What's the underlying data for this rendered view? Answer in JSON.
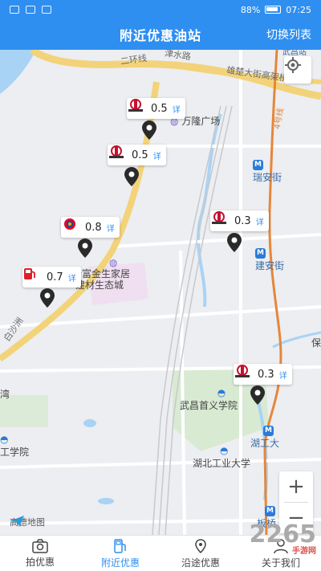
{
  "statusbar": {
    "battery": "88%",
    "time": "07:25"
  },
  "header": {
    "title": "附近优惠油站",
    "switch_label": "切换列表"
  },
  "map": {
    "labels": {
      "ring_road": "二环线",
      "jinshui_road": "津水路",
      "xiongchu_elevated": "雄楚大街高架桥",
      "wuchang_north": "武昌站",
      "line4": "4号线",
      "ruianjie": "瑞安街",
      "jiananjie": "建安街",
      "wanlong_plaza": "万隆广场",
      "hefujin_l1": "合富金生家居",
      "hefujin_l2": "建材生态城",
      "baisha": "白沙洲",
      "wan": "湾",
      "school_left": "工学院",
      "wuchang_shouyi": "武昌首义学院",
      "hugongda": "湖工大",
      "hubei_uni_tech": "湖北工业大学",
      "banqiao": "板桥",
      "bao": "保"
    },
    "stations": [
      {
        "brand": "sinopec",
        "price": "0.5",
        "detail": "详"
      },
      {
        "brand": "sinopec",
        "price": "0.5",
        "detail": "详"
      },
      {
        "brand": "total",
        "price": "0.8",
        "detail": "详"
      },
      {
        "brand": "fuel-pump",
        "price": "0.7",
        "detail": "详"
      },
      {
        "brand": "sinopec",
        "price": "0.3",
        "detail": "详"
      },
      {
        "brand": "sinopec",
        "price": "0.3",
        "detail": "详"
      }
    ],
    "zoom_in": "+",
    "zoom_out": "−",
    "logo_text": "高德地图",
    "colors": {
      "road_yellow": "#f3d37a",
      "metro": "#e6863a",
      "water": "#a9d3f5",
      "green": "#d8ead2"
    }
  },
  "tabs": [
    {
      "label": "拍优惠",
      "icon": "camera-icon",
      "active": false
    },
    {
      "label": "附近优惠",
      "icon": "fuel-pump-icon",
      "active": true
    },
    {
      "label": "沿途优惠",
      "icon": "route-pin-icon",
      "active": false
    },
    {
      "label": "关于我们",
      "icon": "user-icon",
      "active": false
    }
  ],
  "watermark": {
    "text": "2265",
    "sub": "手游网"
  },
  "theme": {
    "primary": "#2f8ff0"
  }
}
